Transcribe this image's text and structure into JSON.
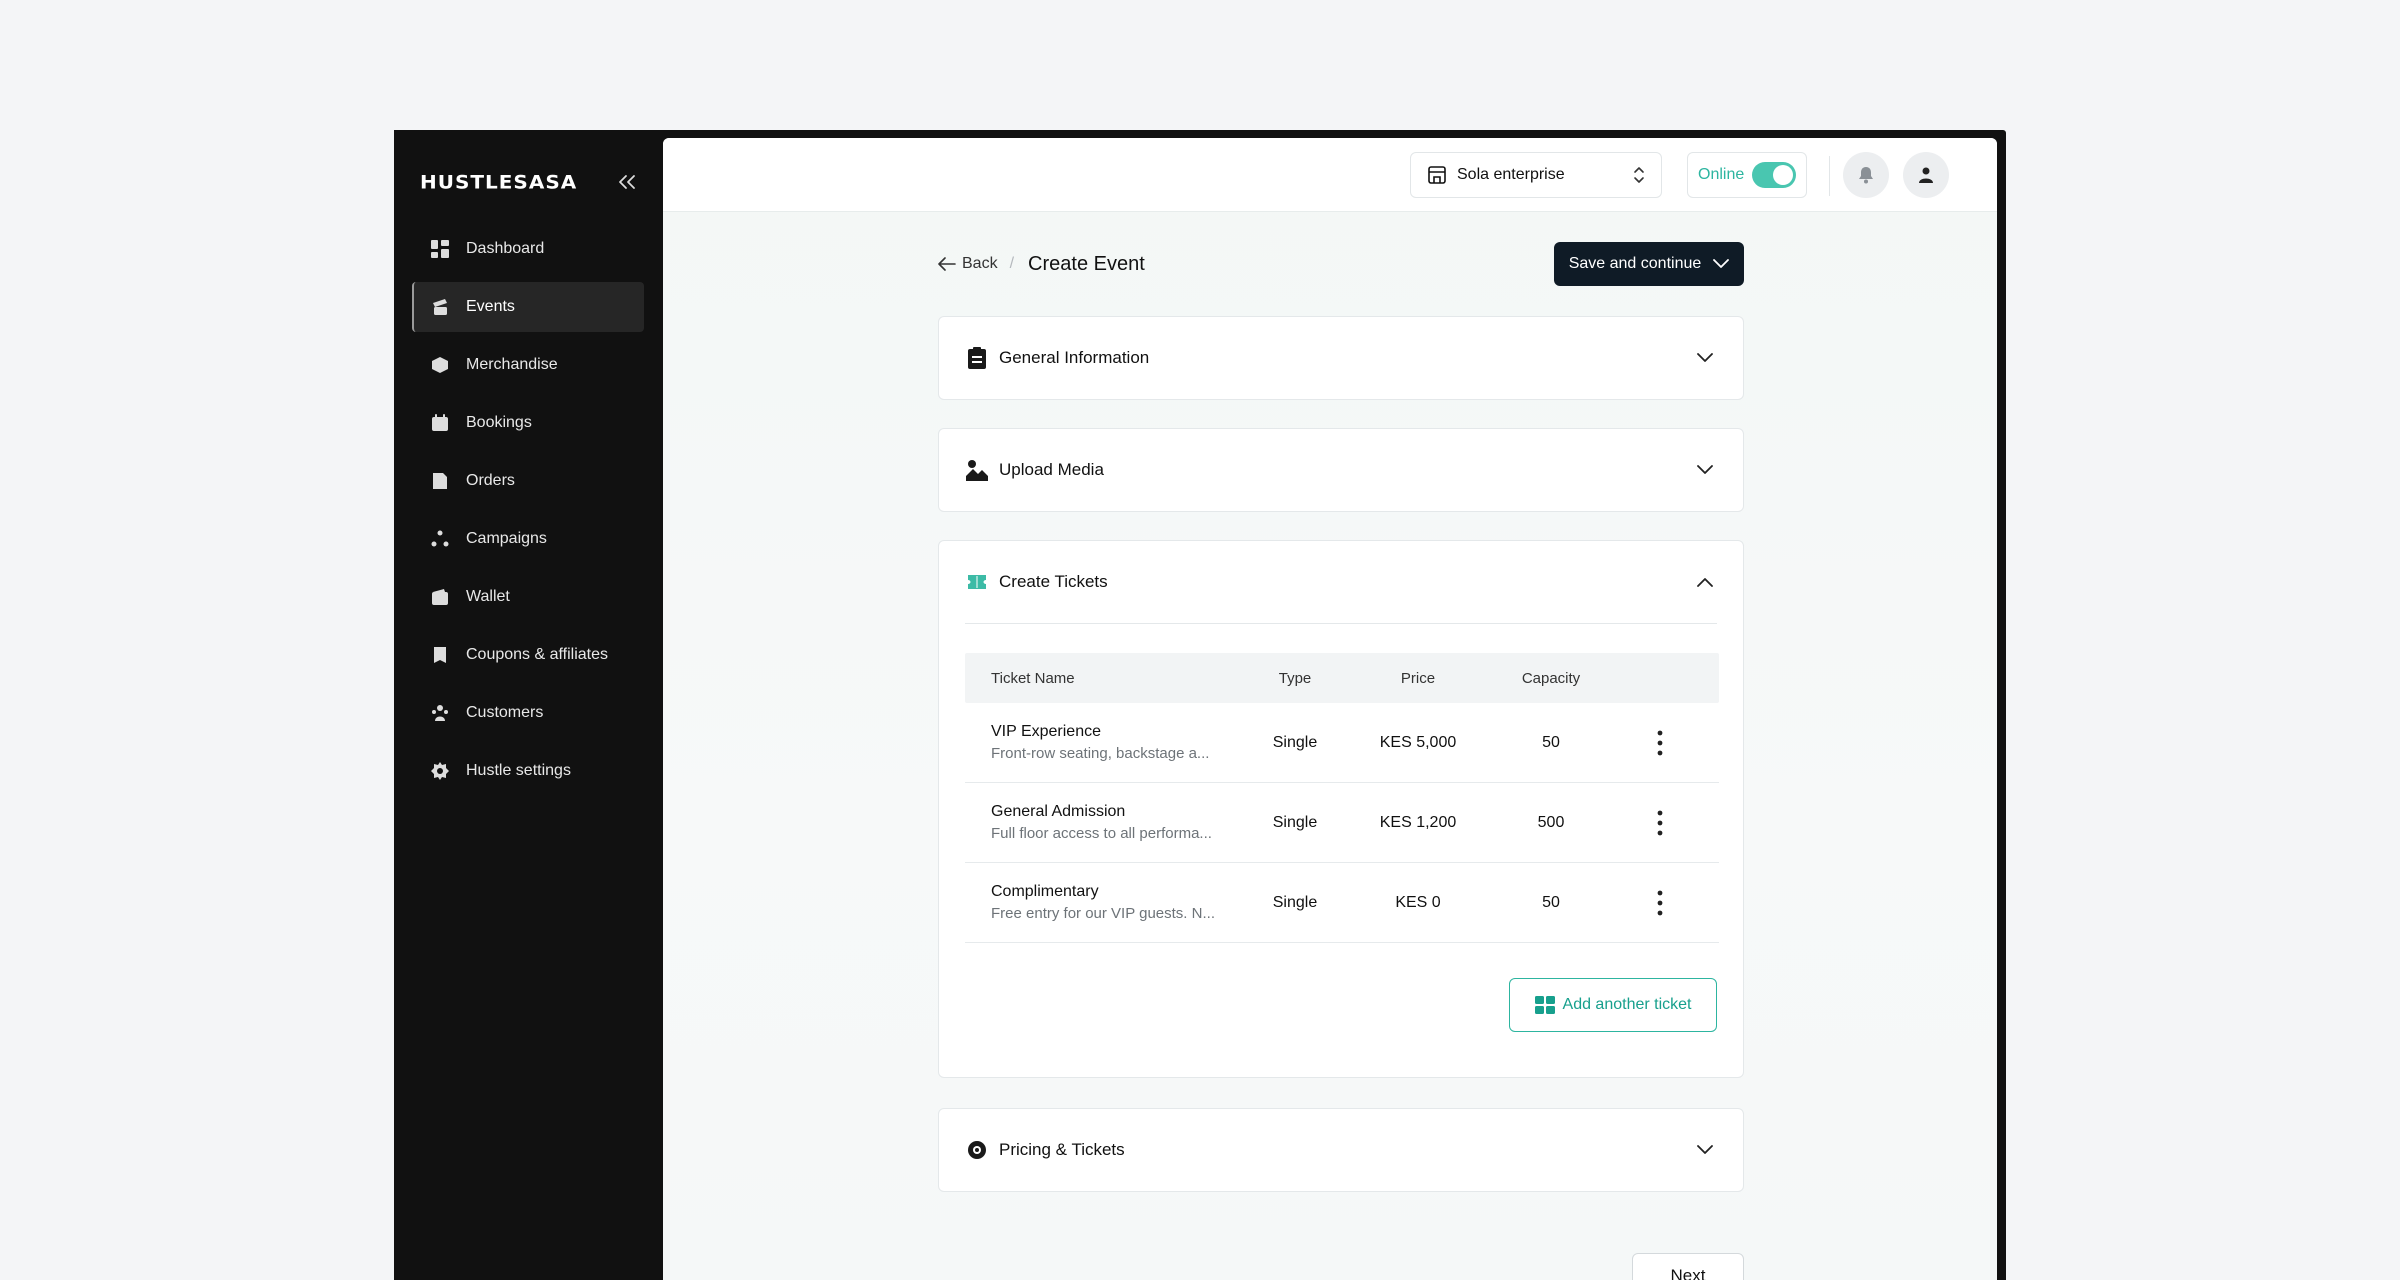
{
  "sidebar": {
    "logo": "HUSTLESASA",
    "items": [
      {
        "label": "Dashboard",
        "icon": "dashboard-icon"
      },
      {
        "label": "Events",
        "icon": "events-icon"
      },
      {
        "label": "Merchandise",
        "icon": "box-icon"
      },
      {
        "label": "Bookings",
        "icon": "calendar-icon"
      },
      {
        "label": "Orders",
        "icon": "orders-icon"
      },
      {
        "label": "Campaigns",
        "icon": "campaigns-icon"
      },
      {
        "label": "Wallet",
        "icon": "wallet-icon"
      },
      {
        "label": "Coupons & affiliates",
        "icon": "coupon-icon"
      },
      {
        "label": "Customers",
        "icon": "customers-icon"
      },
      {
        "label": "Hustle settings",
        "icon": "settings-icon"
      }
    ],
    "active": "Events"
  },
  "topbar": {
    "store": "Sola enterprise",
    "status_label": "Online",
    "online": true
  },
  "header": {
    "back_label": "Back",
    "separator": "/",
    "title": "Create Event",
    "save_label": "Save and continue"
  },
  "sections": {
    "general": "General Information",
    "media": "Upload Media",
    "tickets": "Create Tickets",
    "pricing": "Pricing & Tickets"
  },
  "tickets_table": {
    "columns": [
      "Ticket Name",
      "Type",
      "Price",
      "Capacity"
    ],
    "rows": [
      {
        "name": "VIP Experience",
        "desc": "Front-row seating, backstage a...",
        "type": "Single",
        "price": "KES 5,000",
        "capacity": "50"
      },
      {
        "name": "General Admission",
        "desc": "Full floor access to all performa...",
        "type": "Single",
        "price": "KES 1,200",
        "capacity": "500"
      },
      {
        "name": "Complimentary",
        "desc": "Free entry for our VIP guests. N...",
        "type": "Single",
        "price": "KES 0",
        "capacity": "50"
      }
    ]
  },
  "add_ticket_label": "Add another ticket",
  "next_label": "Next",
  "colors": {
    "accent": "#2db5a0",
    "sidebar_bg": "#111111",
    "primary_button": "#0f1b26"
  }
}
